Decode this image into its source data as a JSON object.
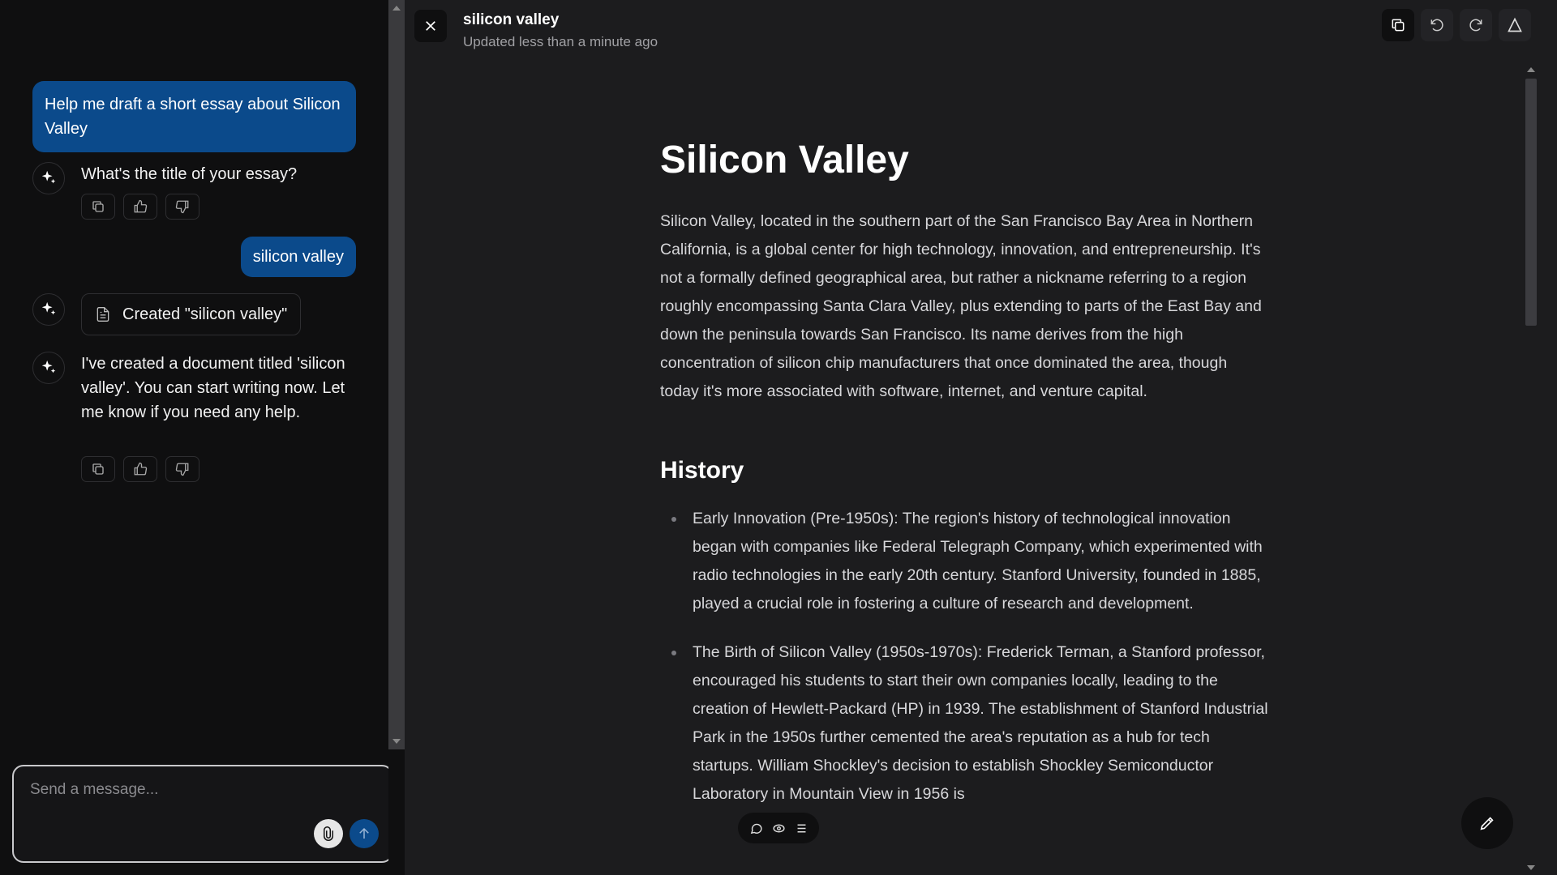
{
  "chat": {
    "messages": [
      {
        "role": "user",
        "text": "Help me draft a short essay about Silicon Valley"
      },
      {
        "role": "assistant",
        "text": "What's the title of your essay?"
      },
      {
        "role": "user",
        "text": "silicon valley"
      },
      {
        "role": "assistant",
        "doc_chip": "Created \"silicon valley\""
      },
      {
        "role": "assistant",
        "text": "I've created a document titled 'silicon valley'. You can start writing now. Let me know if you need any help."
      }
    ],
    "composer": {
      "placeholder": "Send a message..."
    }
  },
  "document": {
    "title": "silicon valley",
    "updated": "Updated less than a minute ago",
    "heading": "Silicon Valley",
    "intro": "Silicon Valley, located in the southern part of the San Francisco Bay Area in Northern California, is a global center for high technology, innovation, and entrepreneurship. It's not a formally defined geographical area, but rather a nickname referring to a region roughly encompassing Santa Clara Valley, plus extending to parts of the East Bay and down the peninsula towards San Francisco. Its name derives from the high concentration of silicon chip manufacturers that once dominated the area, though today it's more associated with software, internet, and venture capital.",
    "section_heading": "History",
    "history_items": [
      "Early Innovation (Pre-1950s): The region's history of technological innovation began with companies like Federal Telegraph Company, which experimented with radio technologies in the early 20th century. Stanford University, founded in 1885, played a crucial role in fostering a culture of research and development.",
      "The Birth of Silicon Valley (1950s-1970s): Frederick Terman, a Stanford professor, encouraged his students to start their own companies locally, leading to the creation of Hewlett-Packard (HP) in 1939. The establishment of Stanford Industrial Park in the 1950s further cemented the area's reputation as a hub for tech startups. William Shockley's decision to establish Shockley Semiconductor Laboratory in Mountain View in 1956 is"
    ]
  },
  "icons": {
    "assistant_avatar": "sparkles-icon",
    "copy": "copy-icon",
    "thumbs_up": "thumbs-up-icon",
    "thumbs_down": "thumbs-down-icon",
    "document": "file-text-icon",
    "attach": "paperclip-icon",
    "send": "arrow-up-icon",
    "close": "close-icon",
    "undo": "undo-icon",
    "redo": "redo-icon",
    "pen": "pen-icon"
  },
  "colors": {
    "user_bubble": "#0b4a8b",
    "sidebar_bg": "#0f0f10",
    "document_bg": "#1c1c1e"
  }
}
